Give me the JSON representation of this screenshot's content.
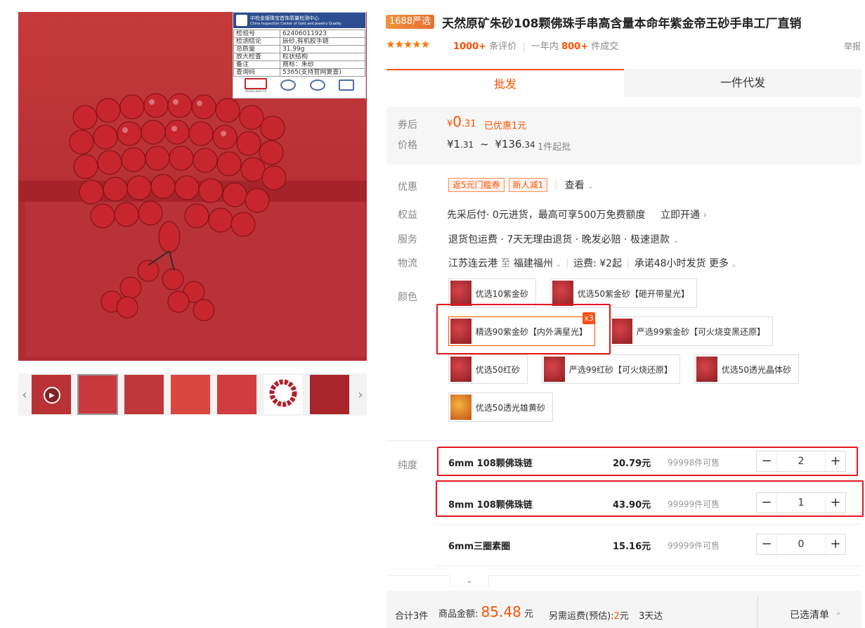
{
  "gallery": {
    "certificate": {
      "org": "中检金银珠宝首饰质量检测中心",
      "org_en": "China Inspection Center of Gold and Jewelry Quality",
      "rows": [
        [
          "检验号",
          "62406011923"
        ],
        [
          "检测结论",
          "辰砂,有机胶手链"
        ],
        [
          "总质量",
          "31.99g"
        ],
        [
          "放大检查",
          "粒状结构"
        ],
        [
          "备注",
          "商标：朱砂"
        ],
        [
          "查询码",
          "5365(支持官网复查)"
        ]
      ],
      "cma_number": "201821340176"
    },
    "nav_prev_icon": "chevron-left-icon",
    "nav_next_icon": "chevron-right-icon"
  },
  "product": {
    "badge": "1688严选",
    "title": "天然原矿朱砂108颗佛珠手串高含量本命年紫金帝王砂手串工厂直销",
    "stars": "★★★★★",
    "review_count": "1000+",
    "review_label": "条评价",
    "sales_prefix": "一年内",
    "sales_count": "800+",
    "sales_label": "件成交",
    "report": "举报"
  },
  "tabs": [
    "批发",
    "一件代发"
  ],
  "price": {
    "after_coupon_label": "券后",
    "currency": "¥",
    "coupon_price_int": "0",
    "coupon_price_dec": ".31",
    "discount": "已优惠1元",
    "price_label": "价格",
    "min_int": "1",
    "min_dec": ".31",
    "tilde": "~",
    "max_int": "136",
    "max_dec": ".34",
    "moq": "1件起批"
  },
  "promo": {
    "label": "优惠",
    "tags": [
      "返5元门槛券",
      "新人减1"
    ],
    "view": "查看"
  },
  "benefit": {
    "label": "权益",
    "text_a": "先采后付",
    "text_b": "· 0元进货，最高可享500万免费额度",
    "link": "立即开通"
  },
  "service": {
    "label": "服务",
    "text": "退货包运费 · 7天无理由退货 · 晚发必赔 · 极速退款"
  },
  "logistics": {
    "label": "物流",
    "from": "江苏连云港",
    "to_word": "至",
    "to": "福建福州",
    "fee": "运费: ¥2起",
    "promise": "承诺48小时发货",
    "more": "更多"
  },
  "color": {
    "label": "颜色",
    "options": [
      "优选10紫金砂",
      "优选50紫金砂【砸开带星光】",
      "精选90紫金砂【内外满星光】",
      "严选99紫金砂【可火烧变黑还原】",
      "优选50红砂",
      "严选99红砂【可火烧还原】",
      "优选50透光晶体砂",
      "优选50透光雄黄砂"
    ],
    "selected_count": "x3"
  },
  "purity": {
    "label": "纯度",
    "rows": [
      {
        "name": "6mm 108颗佛珠链",
        "price": "20.79元",
        "stock": "99998件可售",
        "qty": "2"
      },
      {
        "name": "8mm 108颗佛珠链",
        "price": "43.90元",
        "stock": "99999件可售",
        "qty": "1"
      },
      {
        "name": "6mm三圈素圈",
        "price": "15.16元",
        "stock": "99999件可售",
        "qty": "0"
      }
    ],
    "minus": "−",
    "plus": "+"
  },
  "summary": {
    "total_items": "合计3件",
    "amount_label": "商品金额:",
    "amount": "85.48",
    "amount_unit": "元",
    "shipping_label": "另需运费(预估):",
    "shipping": "2",
    "shipping_unit": "元",
    "days": "3天达",
    "selected_list": "已选清单",
    "selected_list_icon": "chevron-up-icon"
  }
}
